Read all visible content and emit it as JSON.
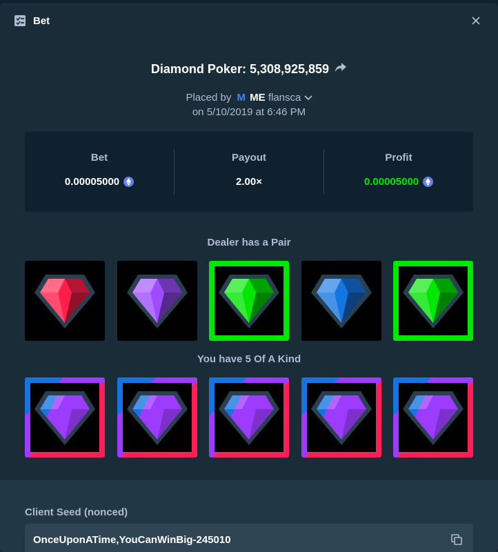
{
  "header": {
    "title": "Bet",
    "icon": "ticket-icon",
    "close_icon": "close-icon"
  },
  "game": {
    "title": "Diamond Poker: 5,308,925,859",
    "share_icon": "share-icon"
  },
  "placed": {
    "prefix": "Placed by",
    "vip_badge": "M",
    "user_tag": "ME",
    "username": "flansca",
    "date_line": "on 5/10/2019 at 6:46 PM"
  },
  "stats": {
    "bet_label": "Bet",
    "bet_value": "0.00005000",
    "payout_label": "Payout",
    "payout_value": "2.00×",
    "profit_label": "Profit",
    "profit_value": "0.00005000",
    "currency_icon": "ethereum-icon"
  },
  "dealer": {
    "label": "Dealer has a Pair",
    "cards": [
      {
        "gem": "red-diamond-icon",
        "color": "#ff1f4a",
        "highlight": false
      },
      {
        "gem": "purple-diamond-icon",
        "color": "#9d4cff",
        "highlight": false
      },
      {
        "gem": "green-diamond-icon",
        "color": "#00e701",
        "highlight": true
      },
      {
        "gem": "blue-diamond-icon",
        "color": "#1475e1",
        "highlight": false
      },
      {
        "gem": "green-diamond-icon",
        "color": "#00e701",
        "highlight": true
      }
    ]
  },
  "player": {
    "label": "You have 5 Of A Kind",
    "cards": [
      {
        "gem": "multicolor-diamond-icon"
      },
      {
        "gem": "multicolor-diamond-icon"
      },
      {
        "gem": "multicolor-diamond-icon"
      },
      {
        "gem": "multicolor-diamond-icon"
      },
      {
        "gem": "multicolor-diamond-icon"
      }
    ]
  },
  "seed": {
    "label": "Client Seed (nonced)",
    "value": "OnceUponATime,YouCanWinBig-245010",
    "copy_icon": "copy-icon"
  },
  "colors": {
    "background": "#1a2c38",
    "panel": "#0f212e",
    "profit": "#00e701",
    "muted_text": "#b1bad3"
  }
}
